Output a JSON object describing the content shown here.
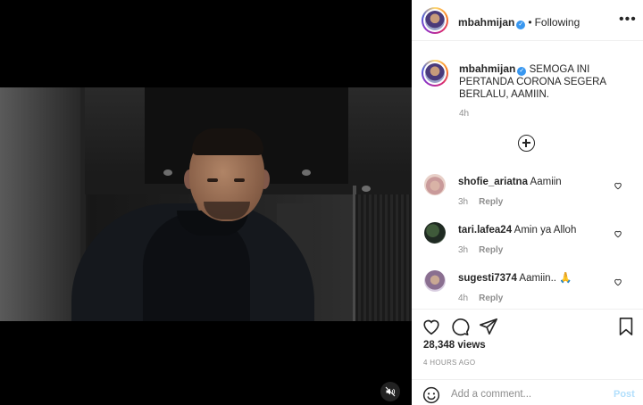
{
  "post": {
    "username": "mbahmijan",
    "verified_icon": "verified-badge-icon",
    "separator": "•",
    "follow_state": "Following",
    "more_icon": "more-options-icon",
    "more_glyph": "•••",
    "caption": "SEMOGA INI PERTANDA CORONA SEGERA BERLALU, AAMIIN.",
    "caption_time": "4h",
    "load_more_icon": "plus-circle-icon"
  },
  "comments": [
    {
      "username": "shofie_ariatna",
      "text": "Aamiin",
      "time": "3h",
      "reply": "Reply"
    },
    {
      "username": "tari.lafea24",
      "text": "Amin ya Alloh",
      "time": "3h",
      "reply": "Reply"
    },
    {
      "username": "sugesti7374",
      "text": "Aamiin.. 🙏",
      "time": "4h",
      "reply": "Reply"
    }
  ],
  "stats": {
    "views": "28,348 views",
    "posted_ago": "4 HOURS AGO"
  },
  "add_comment": {
    "placeholder": "Add a comment...",
    "post_label": "Post"
  },
  "video": {
    "mute_icon": "muted-speaker-icon"
  },
  "colors": {
    "verified": "#3897f0",
    "post_disabled": "#b2dffc",
    "muted_text": "#8e8e8e"
  }
}
